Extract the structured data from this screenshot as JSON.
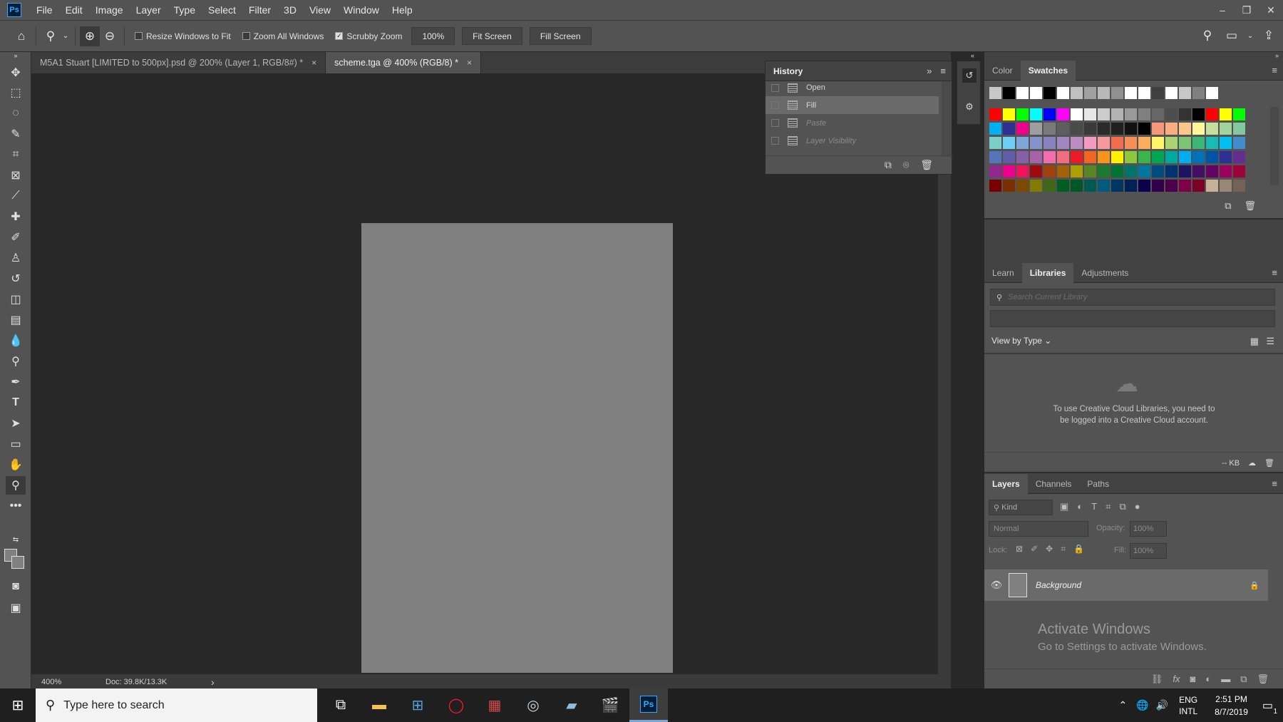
{
  "menu": {
    "logo": "Ps",
    "items": [
      "File",
      "Edit",
      "Image",
      "Layer",
      "Type",
      "Select",
      "Filter",
      "3D",
      "View",
      "Window",
      "Help"
    ]
  },
  "window_controls": {
    "minimize": "–",
    "restore": "❐",
    "close": "✕"
  },
  "options_bar": {
    "resize_windows": "Resize Windows to Fit",
    "zoom_all_windows": "Zoom All Windows",
    "scrubby_zoom": "Scrubby Zoom",
    "zoom_value": "100%",
    "fit_screen": "Fit Screen",
    "fill_screen": "Fill Screen"
  },
  "tabs": [
    {
      "title": "M5A1 Stuart [LIMITED to 500px].psd @ 200% (Layer 1, RGB/8#) *",
      "close": "×"
    },
    {
      "title": "scheme.tga @ 400% (RGB/8) *",
      "close": "×"
    }
  ],
  "status": {
    "zoom": "400%",
    "doc": "Doc: 39.8K/13.3K",
    "arrow": "›"
  },
  "history": {
    "title": "History",
    "items": [
      "Open",
      "Fill",
      "Paste",
      "Layer Visibility"
    ]
  },
  "color_panel": {
    "tab_color": "Color",
    "tab_swatches": "Swatches"
  },
  "swatches": {
    "row0": [
      "#c8c8c8",
      "#000000",
      "#ffffff",
      "#ffffff",
      "#000000",
      "#ffffff",
      "#c0c0c0",
      "#a0a0a0",
      "#b8b8b8",
      "#909090",
      "#ffffff",
      "#ffffff",
      "#404040",
      "#ffffff",
      "#c8c8c8",
      "#808080",
      "#ffffff"
    ],
    "grid": [
      [
        "#ff0000",
        "#ffff00",
        "#00ff00",
        "#00ffff",
        "#0000ff",
        "#ff00ff",
        "#ffffff",
        "#e6e6e6",
        "#cccccc",
        "#b3b3b3",
        "#999999",
        "#808080",
        "#666666",
        "#4d4d4d",
        "#333333",
        "#000000",
        "#ff0000",
        "#ffff00",
        "#00ff00"
      ],
      [
        "#00b0f0",
        "#2e3192",
        "#ec008c",
        "#9e9e9e",
        "#7a7a7a",
        "#5e5e5e",
        "#4a4a4a",
        "#3a3a3a",
        "#2a2a2a",
        "#202020",
        "#111111",
        "#000000",
        "#f7977a",
        "#f9ad81",
        "#fdc68a",
        "#fff79a",
        "#c4df9b",
        "#a3d39c",
        "#82ca9d"
      ],
      [
        "#7bcdc8",
        "#6ecff6",
        "#7ea7d8",
        "#8493ca",
        "#8882be",
        "#a187be",
        "#bc8dbf",
        "#f49ac2",
        "#f6989d",
        "#f26c4f",
        "#f68e56",
        "#fbaf5c",
        "#fff467",
        "#acd372",
        "#7cc576",
        "#3bb878",
        "#1abbb4",
        "#00bff3",
        "#438ccb"
      ],
      [
        "#5574b9",
        "#605ca8",
        "#855fa8",
        "#a763a8",
        "#f06eaa",
        "#f26d7d",
        "#ed1c24",
        "#f26522",
        "#f7941d",
        "#fff200",
        "#8dc73f",
        "#39b54a",
        "#00a651",
        "#00a99d",
        "#00aeef",
        "#0072bc",
        "#0054a6",
        "#2e3192",
        "#662d91"
      ],
      [
        "#92278f",
        "#ec008c",
        "#ed145b",
        "#9e0b0f",
        "#a0410d",
        "#a36209",
        "#aba000",
        "#598527",
        "#1a7b30",
        "#007236",
        "#00746b",
        "#0076a3",
        "#004b80",
        "#003471",
        "#1b1464",
        "#440e62",
        "#630460",
        "#9e005d",
        "#9e0039"
      ],
      [
        "#790000",
        "#7b2e00",
        "#7d4900",
        "#827b00",
        "#406618",
        "#005e20",
        "#005826",
        "#005952",
        "#005b7f",
        "#003663",
        "#002157",
        "#0d004c",
        "#32004b",
        "#4b0049",
        "#7b0046",
        "#7a0026",
        "#c7b299",
        "#998675",
        "#736357"
      ]
    ]
  },
  "libraries": {
    "tab_learn": "Learn",
    "tab_libraries": "Libraries",
    "tab_adjust": "Adjustments",
    "search_placeholder": "Search Current Library",
    "view_by": "View by Type",
    "message": "To use Creative Cloud Libraries, you need to be logged into a Creative Cloud account.",
    "size": "-- KB"
  },
  "layers": {
    "tab_layers": "Layers",
    "tab_channels": "Channels",
    "tab_paths": "Paths",
    "kind": "Kind",
    "blend": "Normal",
    "opacity_label": "Opacity:",
    "opacity": "100%",
    "lock_label": "Lock:",
    "fill_label": "Fill:",
    "fill": "100%",
    "layer_name": "Background"
  },
  "watermark": {
    "title": "Activate Windows",
    "sub": "Go to Settings to activate Windows."
  },
  "taskbar": {
    "search": "Type here to search",
    "lang1": "ENG",
    "lang2": "INTL",
    "time": "2:51 PM",
    "date": "8/7/2019",
    "notif": "1"
  }
}
